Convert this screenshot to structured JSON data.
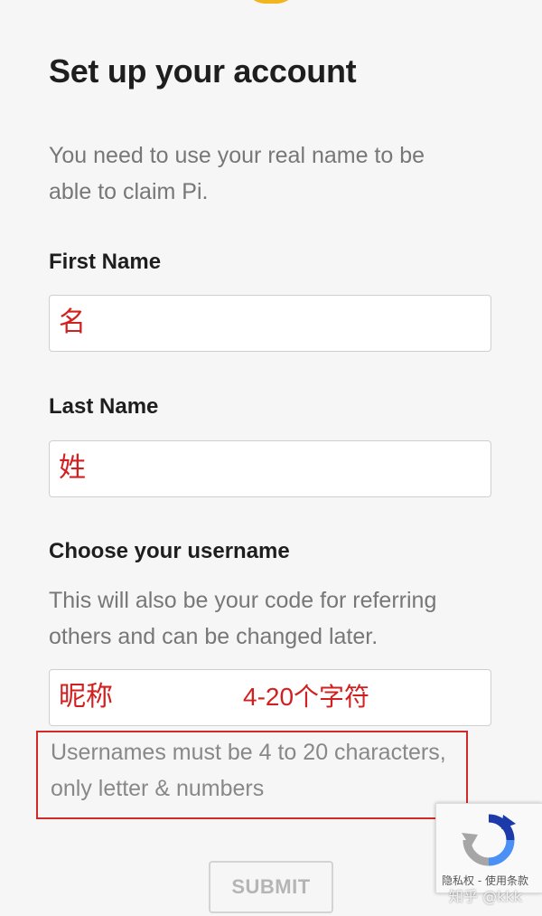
{
  "form": {
    "title": "Set up your account",
    "intro": "You need to use your real name to be able to claim Pi.",
    "first_name": {
      "label": "First Name",
      "value": "名"
    },
    "last_name": {
      "label": "Last Name",
      "value": "姓"
    },
    "username": {
      "label": "Choose your username",
      "help": "This will also be your code for referring others and can be changed later.",
      "value": "昵称",
      "annotation": "4-20个字符",
      "rule": "Usernames must be 4 to 20 characters, only letter & numbers"
    },
    "submit_label": "SUBMIT"
  },
  "recaptcha": {
    "legal": "隐私权 - 使用条款"
  },
  "watermark": "知乎 @kkk",
  "colors": {
    "annotation_red": "#d21f1f",
    "logo_gold": "#f2b51e"
  }
}
